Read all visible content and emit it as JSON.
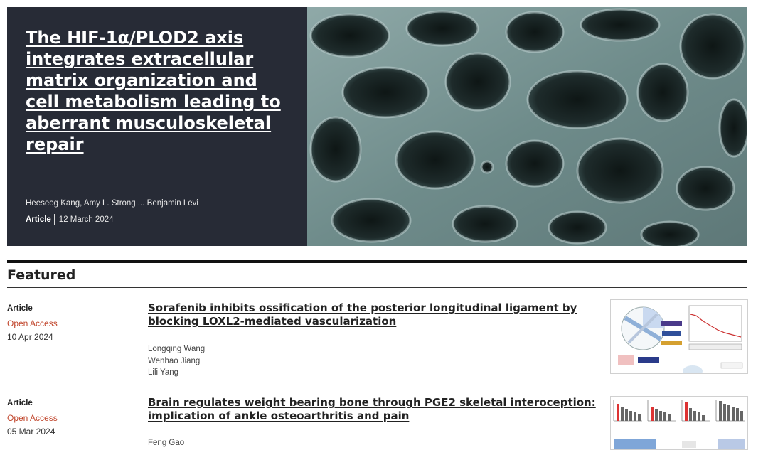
{
  "hero": {
    "title": "The HIF-1α/PLOD2 axis integrates extracellular matrix organization and cell metabolism leading to aberrant musculoskeletal repair",
    "authors": "Heeseog Kang, Amy L. Strong ... Benjamin Levi",
    "article_type": "Article",
    "date": "12 March 2024",
    "image_icon": "bone-micrograph-image"
  },
  "featured": {
    "heading": "Featured",
    "items": [
      {
        "type": "Article",
        "access": "Open Access",
        "date": "10 Apr 2024",
        "title": "Sorafenib inhibits ossification of the posterior longitudinal ligament by blocking LOXL2-mediated vascularization",
        "authors": [
          "Longqing Wang",
          "Wenhao Jiang",
          "Lili Yang"
        ],
        "thumb_icon": "figure-thumbnail-chord-diagram"
      },
      {
        "type": "Article",
        "access": "Open Access",
        "date": "05 Mar 2024",
        "title": "Brain regulates weight bearing bone through PGE2 skeletal interoception: implication of ankle osteoarthritis and pain",
        "authors": [
          "Feng Gao"
        ],
        "thumb_icon": "figure-thumbnail-bar-charts"
      }
    ]
  },
  "colors": {
    "hero_panel": "#272b36",
    "open_access": "#c0442a"
  }
}
